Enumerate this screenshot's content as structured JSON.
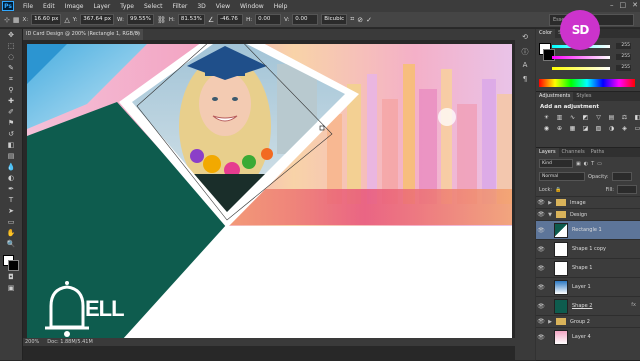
{
  "app": {
    "logo": "Ps",
    "menu": [
      "File",
      "Edit",
      "Image",
      "Layer",
      "Type",
      "Select",
      "Filter",
      "3D",
      "View",
      "Window",
      "Help"
    ]
  },
  "options": {
    "x_label": "X:",
    "x_value": "16.60 px",
    "y_label": "Y:",
    "y_value": "367.64 px",
    "w_label": "W:",
    "w_value": "99.55%",
    "h_label": "H:",
    "h_value": "81.53%",
    "angle_value": "-46.76",
    "hskew_label": "H:",
    "hskew_value": "0.00",
    "vskew_label": "V:",
    "vskew_value": "0.00",
    "interp_value": "Bicubic",
    "workspace": "Essentials"
  },
  "document": {
    "tab_title": "ID Card Design @ 200% (Rectangle 1, RGB/8) *",
    "close": "×"
  },
  "status": {
    "zoom": "200%",
    "doc": "Doc: 1.88M/5.41M"
  },
  "card": {
    "bell_text": "ELL"
  },
  "colors": {
    "teal": "#0e5c4e",
    "purple": "#cc33cc",
    "selection": "#5d7599"
  },
  "color_panel": {
    "tabs": [
      "Color",
      "Swatches"
    ],
    "r": "255",
    "g": "255",
    "b": "255"
  },
  "adjustments": {
    "tabs": [
      "Adjustments",
      "Styles"
    ],
    "title": "Add an adjustment"
  },
  "layers": {
    "tabs": [
      "Layers",
      "Channels",
      "Paths"
    ],
    "kind": "Kind",
    "blend_mode": "Normal",
    "opacity_label": "Opacity:",
    "lock_label": "Lock:",
    "fill_label": "Fill:",
    "items": [
      {
        "name": "Image",
        "type": "group",
        "expanded": false
      },
      {
        "name": "Design",
        "type": "group",
        "expanded": true
      },
      {
        "name": "Rectangle 1",
        "type": "layer",
        "selected": true
      },
      {
        "name": "Shape 1 copy",
        "type": "layer"
      },
      {
        "name": "Shape 1",
        "type": "layer"
      },
      {
        "name": "Layer 1",
        "type": "layer"
      },
      {
        "name": "Shape 2",
        "type": "layer",
        "fx": true
      },
      {
        "name": "Group 2",
        "type": "group",
        "expanded": false
      },
      {
        "name": "Layer 4",
        "type": "layer"
      }
    ]
  },
  "watermark": {
    "text": "SD"
  }
}
